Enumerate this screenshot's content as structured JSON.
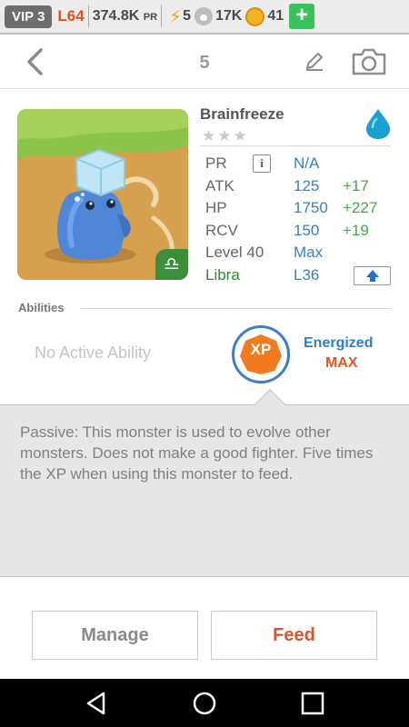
{
  "status_bar": {
    "vip": "VIP 3",
    "level": "L64",
    "power": "374.8K",
    "power_unit": "PR",
    "energy": "5",
    "paws": "17K",
    "coins": "41",
    "add_label": "+"
  },
  "nav": {
    "page_number": "5"
  },
  "monster": {
    "name": "Brainfreeze",
    "stars": "★★★",
    "element_icon": "water-drop-icon",
    "sign_icon": "libra-icon",
    "sign_glyph": "♎"
  },
  "stats": {
    "pr_label": "PR",
    "pr_info": "i",
    "pr_value": "N/A",
    "atk_label": "ATK",
    "atk_value": "125",
    "atk_bonus": "+17",
    "hp_label": "HP",
    "hp_value": "1750",
    "hp_bonus": "+227",
    "rcv_label": "RCV",
    "rcv_value": "150",
    "rcv_bonus": "+19",
    "level_label": "Level 40",
    "level_value": "Max",
    "sign_label": "Libra",
    "sign_level": "L36"
  },
  "abilities": {
    "section_label": "Abilities",
    "active": "No Active Ability",
    "badge_text": "XP",
    "passive_name": "Energized",
    "passive_level": "MAX",
    "passive_description": "Passive: This monster is used to evolve other monsters. Does not make a good fighter. Five times the XP when using this monster to feed."
  },
  "actions": {
    "manage": "Manage",
    "feed": "Feed"
  },
  "colors": {
    "accent_blue": "#2d7fc8",
    "accent_orange": "#e0502a",
    "bonus_green": "#47a847"
  }
}
